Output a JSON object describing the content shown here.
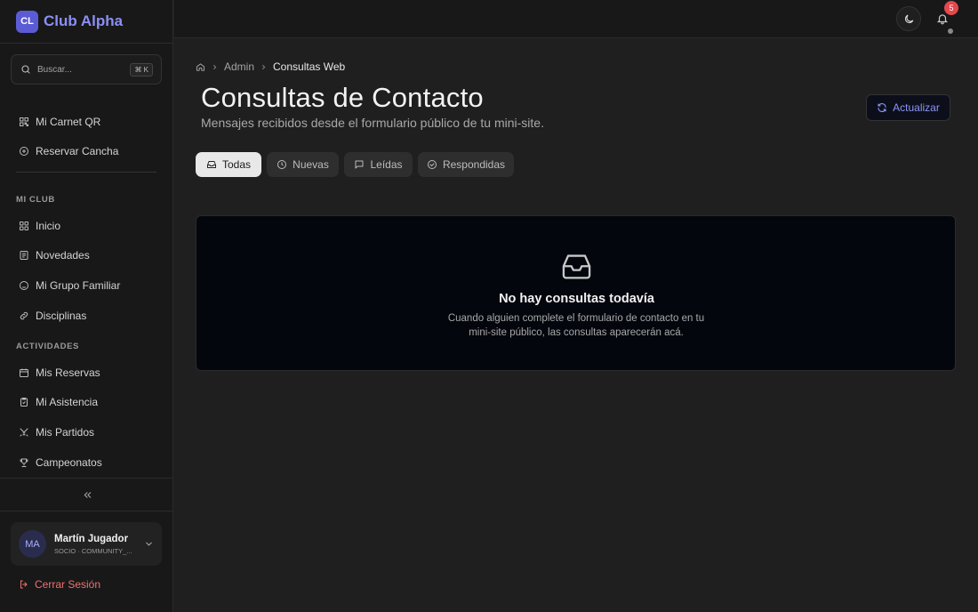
{
  "brand": {
    "logo": "CL",
    "name": "Club Alpha"
  },
  "search": {
    "placeholder": "Buscar...",
    "shortcut": "⌘ K"
  },
  "sidebar": {
    "quick": [
      {
        "label": "Mi Carnet QR",
        "icon": "qr-code-icon"
      },
      {
        "label": "Reservar Cancha",
        "icon": "plus-circle-icon"
      }
    ],
    "sections": [
      {
        "title": "MI CLUB",
        "items": [
          {
            "label": "Inicio",
            "icon": "grid-icon"
          },
          {
            "label": "Novedades",
            "icon": "newspaper-icon"
          },
          {
            "label": "Mi Grupo Familiar",
            "icon": "family-icon"
          },
          {
            "label": "Disciplinas",
            "icon": "link-icon"
          }
        ]
      },
      {
        "title": "ACTIVIDADES",
        "items": [
          {
            "label": "Mis Reservas",
            "icon": "calendar-icon"
          },
          {
            "label": "Mi Asistencia",
            "icon": "clipboard-check-icon"
          },
          {
            "label": "Mis Partidos",
            "icon": "swords-icon"
          },
          {
            "label": "Campeonatos",
            "icon": "trophy-icon"
          }
        ]
      }
    ],
    "user": {
      "initials": "MA",
      "name": "Martín Jugador",
      "role": "SOCIO · COMMUNITY_..."
    },
    "logout": "Cerrar Sesión"
  },
  "topbar": {
    "notifications": "5"
  },
  "breadcrumb": {
    "items": [
      "Admin",
      "Consultas Web"
    ]
  },
  "page": {
    "title": "Consultas de Contacto",
    "subtitle": "Mensajes recibidos desde el formulario público de tu mini-site.",
    "refresh": "Actualizar"
  },
  "tabs": [
    {
      "label": "Todas",
      "active": true
    },
    {
      "label": "Nuevas",
      "active": false
    },
    {
      "label": "Leídas",
      "active": false
    },
    {
      "label": "Respondidas",
      "active": false
    }
  ],
  "empty": {
    "title": "No hay consultas todavía",
    "description": "Cuando alguien complete el formulario de contacto en tu mini-site público, las consultas aparecerán acá."
  },
  "colors": {
    "accent": "#5b5bd6",
    "accent_text": "#8b95f7",
    "danger": "#e5484d",
    "logout": "#f07070"
  }
}
